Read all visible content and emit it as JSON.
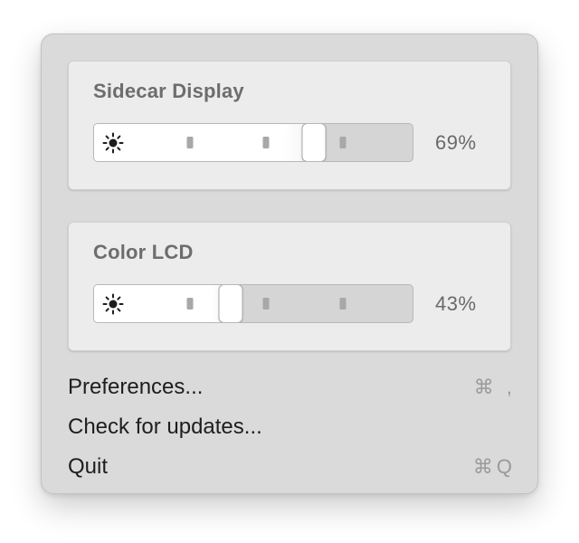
{
  "displays": [
    {
      "name": "Sidecar Display",
      "brightness_label": "69%",
      "brightness": 0.69
    },
    {
      "name": "Color LCD",
      "brightness_label": "43%",
      "brightness": 0.43
    }
  ],
  "slider": {
    "tick_fractions": [
      0.3,
      0.54,
      0.78
    ],
    "icon": "sun-icon"
  },
  "menu": {
    "preferences": {
      "label": "Preferences...",
      "shortcut": "⌘ ,"
    },
    "updates": {
      "label": "Check for updates..."
    },
    "quit": {
      "label": "Quit",
      "shortcut": "⌘Q"
    }
  },
  "colors": {
    "menu_background": "#dadada",
    "card_background": "#ececec",
    "slider_fill": "#ffffff",
    "slider_track": "#d5d5d5",
    "title_text": "#6d6d6d",
    "menu_text": "#1e1e1e",
    "shortcut_text": "#9a9a9a"
  }
}
